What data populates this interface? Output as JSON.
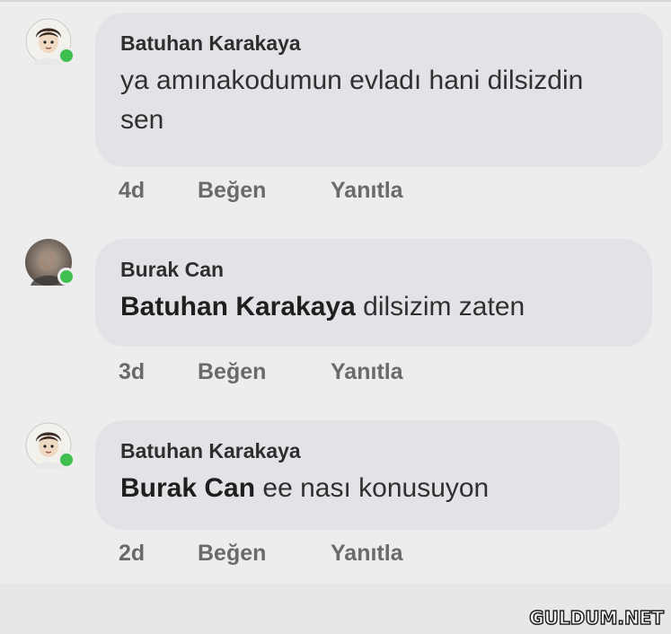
{
  "comments": [
    {
      "author": "Batuhan Karakaya",
      "mention": "",
      "text": "ya amınakodumun evladı hani dilsizdin sen",
      "time": "4d",
      "like_label": "Beğen",
      "reply_label": "Yanıtla",
      "avatar_icon": "cartoon-avatar-icon"
    },
    {
      "author": "Burak Can",
      "mention": "Batuhan Karakaya",
      "text": "dilsizim zaten",
      "time": "3d",
      "like_label": "Beğen",
      "reply_label": "Yanıtla",
      "avatar_icon": "photo-avatar-icon"
    },
    {
      "author": "Batuhan Karakaya",
      "mention": "Burak Can",
      "text": "ee nası konusuyon",
      "time": "2d",
      "like_label": "Beğen",
      "reply_label": "Yanıtla",
      "avatar_icon": "cartoon-avatar-icon"
    }
  ],
  "watermark": "GULDUM.NET",
  "colors": {
    "background": "#ededed",
    "bubble": "#e2e3e6",
    "online": "#3fbf4f",
    "meta_text": "#6a6a6a"
  }
}
